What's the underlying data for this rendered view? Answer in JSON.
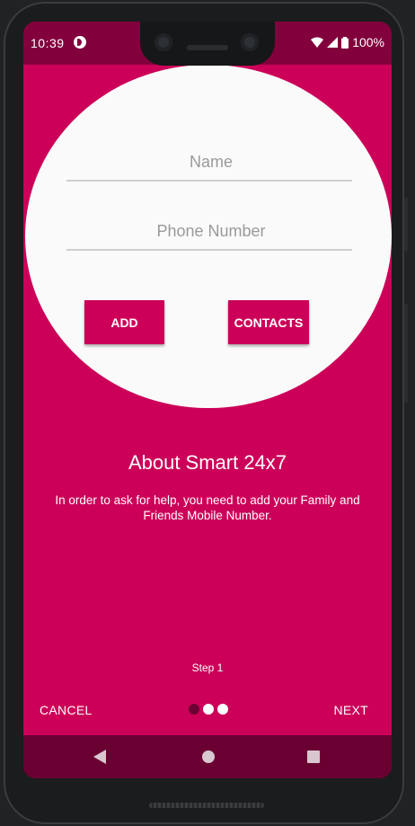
{
  "status_bar": {
    "time": "10:39",
    "battery": "100%",
    "icons": [
      "app-notification-icon",
      "wifi-icon",
      "signal-icon",
      "battery-icon"
    ]
  },
  "form": {
    "name_placeholder": "Name",
    "phone_placeholder": "Phone Number",
    "add_label": "ADD",
    "contacts_label": "CONTACTS"
  },
  "intro": {
    "title": "About Smart 24x7",
    "description": "In order to ask for help, you need to add your Family and Friends Mobile Number."
  },
  "stepper": {
    "step_label": "Step 1",
    "cancel_label": "CANCEL",
    "next_label": "NEXT",
    "total_steps": 3,
    "current_step": 1
  },
  "nav_bar": {
    "buttons": [
      "back-icon",
      "home-icon",
      "recents-icon"
    ]
  },
  "colors": {
    "primary": "#cc0058",
    "status_bar": "#82003c",
    "nav_bar": "#6a0031",
    "circle_bg": "#fafafa"
  }
}
